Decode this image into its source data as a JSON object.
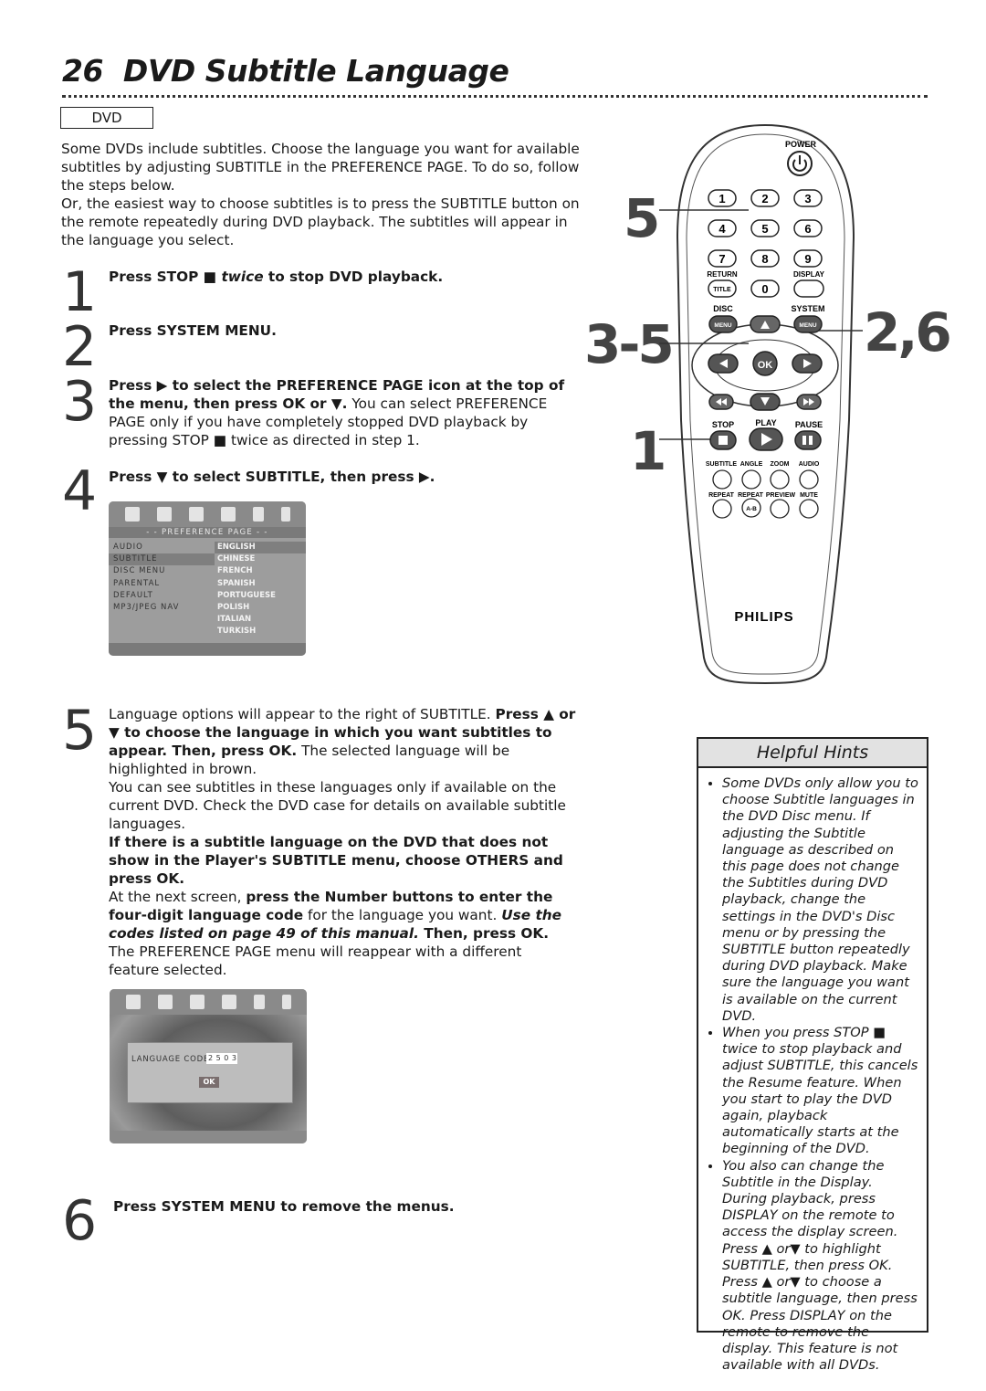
{
  "header": {
    "page_number": "26",
    "title": "DVD Subtitle Language",
    "disc_badge": "DVD"
  },
  "intro": [
    [
      {
        "t": "Some DVDs include subtitles. Choose the language you want for available subtitles by adjusting SUBTITLE in the PREFERENCE PAGE. To do so, follow the steps below."
      }
    ],
    [
      {
        "t": "Or, the easiest way to choose subtitles is to press the SUBTITLE button on the remote repeatedly during DVD playback. The subtitles will appear in the language you select."
      }
    ]
  ],
  "steps": [
    {
      "number": "1",
      "text": [
        {
          "t": "Press STOP ■ ",
          "s": "b"
        },
        {
          "t": "twice",
          "s": "bi"
        },
        {
          "t": " to stop DVD playback.",
          "s": "b"
        }
      ]
    },
    {
      "number": "2",
      "text": [
        {
          "t": "Press SYSTEM MENU.",
          "s": "b"
        }
      ]
    },
    {
      "number": "3",
      "text": [
        {
          "t": "Press ▶ to select the PREFERENCE PAGE icon at the top of the menu, then press OK or ▼.",
          "s": "b"
        },
        {
          "t": " You can select PREFERENCE PAGE only if you have completely stopped DVD playback by pressing STOP ■ twice as directed in step 1."
        }
      ]
    },
    {
      "number": "4",
      "text": [
        {
          "t": "Press ▼ to select SUBTITLE, then press ▶.",
          "s": "b"
        }
      ]
    },
    {
      "number": "5",
      "text": [
        {
          "t": "Language options will appear to the right of SUBTITLE. "
        },
        {
          "t": "Press ▲ or ▼ to choose the language in which you want subtitles to appear. Then, press OK.",
          "s": "b"
        },
        {
          "t": " The selected language will be highlighted in brown."
        }
      ],
      "para2": [
        {
          "t": "You can see subtitles in these languages only if available on the current DVD. Check the DVD case for details on available subtitle languages."
        }
      ],
      "para3": [
        {
          "t": "If there is a subtitle language on the DVD that does not show in the Player's SUBTITLE menu, choose OTHERS and press OK.",
          "s": "b"
        }
      ],
      "para4": [
        {
          "t": "At the next screen, "
        },
        {
          "t": "press the Number buttons to enter the four-digit language code",
          "s": "b"
        },
        {
          "t": " for the language you want. "
        },
        {
          "t": "Use the codes listed on page 49 of this manual.",
          "s": "bi"
        },
        {
          "t": " Then, press OK.",
          "s": "b"
        },
        {
          "t": " The PREFERENCE PAGE menu will reappear with a different feature selected."
        }
      ]
    },
    {
      "number": "6",
      "text": [
        {
          "t": "Press SYSTEM MENU to remove the menus.",
          "s": "b"
        }
      ]
    }
  ],
  "screen1": {
    "header": "- -  PREFERENCE  PAGE  - -",
    "menu_items": [
      "AUDIO",
      "SUBTITLE",
      "DISC  MENU",
      "PARENTAL",
      "DEFAULT",
      "MP3/JPEG  NAV"
    ],
    "selected_item": "SUBTITLE",
    "languages": [
      "ENGLISH",
      "CHINESE",
      "FRENCH",
      "SPANISH",
      "PORTUGUESE",
      "POLISH",
      "ITALIAN",
      "TURKISH"
    ],
    "selected_language": "ENGLISH"
  },
  "screen2": {
    "label": "LANGUAGE  CODE",
    "code": "2 5 0 3",
    "ok": "OK"
  },
  "remote": {
    "power": "POWER",
    "digits": [
      "1",
      "2",
      "3",
      "4",
      "5",
      "6",
      "7",
      "8",
      "9"
    ],
    "return": "RETURN",
    "display": "DISPLAY",
    "title": "TITLE",
    "zero": "0",
    "disc": "DISC",
    "system": "SYSTEM",
    "menu": "MENU",
    "ok": "OK",
    "stop": "STOP",
    "play": "PLAY",
    "pause": "PAUSE",
    "subtitle": "SUBTITLE",
    "angle": "ANGLE",
    "zoom": "ZOOM",
    "audio": "AUDIO",
    "repeat": "REPEAT",
    "repeat_ab": "REPEAT",
    "ab": "A-B",
    "preview": "PREVIEW",
    "mute": "MUTE",
    "brand": "PHILIPS",
    "callouts": {
      "c5": "5",
      "c35": "3-5",
      "c1": "1",
      "c26": "2,6"
    }
  },
  "hints": {
    "title": "Helpful Hints",
    "items": [
      "Some DVDs only allow you to choose Subtitle languages in the DVD Disc menu. If adjusting the Subtitle language as described on this page does not change the Subtitles during DVD playback, change the settings in the DVD's Disc menu or by pressing the SUBTITLE button repeatedly during DVD playback. Make sure the language you want is available on the current DVD.",
      "When you press STOP ■ twice to stop playback and adjust SUBTITLE, this cancels the Resume feature. When you start to play the DVD again, playback automatically starts at the beginning of the DVD.",
      "You also can change the Subtitle in the Display. During playback, press DISPLAY on the remote to access the display screen. Press ▲ or▼ to highlight SUBTITLE, then press OK. Press ▲ or▼ to choose a subtitle language, then press OK. Press DISPLAY on the remote to remove the display. This feature is not available with all DVDs."
    ]
  }
}
